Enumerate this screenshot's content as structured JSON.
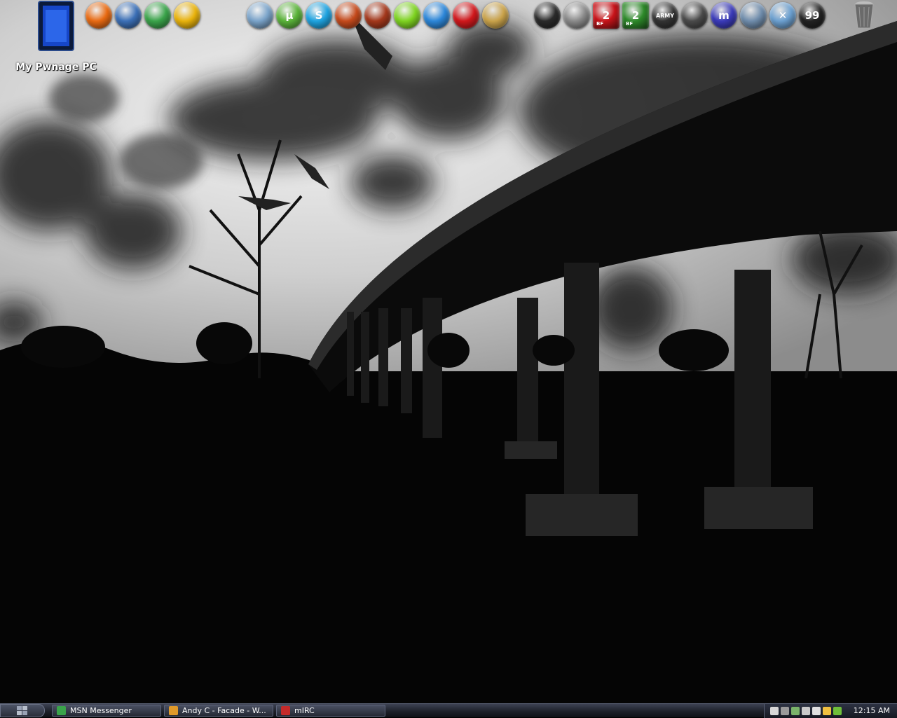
{
  "desktop": {
    "my_computer_label": "My Pwnage PC"
  },
  "dock_left": [
    {
      "name": "firefox-icon",
      "color": "#e86a12"
    },
    {
      "name": "thunderbird-icon",
      "color": "#3b6fb6"
    },
    {
      "name": "msn-icon",
      "color": "#3aa34a"
    },
    {
      "name": "aim-icon",
      "color": "#e8b20c"
    }
  ],
  "dock_center": [
    {
      "name": "feather-icon",
      "color": "#7aa3c9"
    },
    {
      "name": "utorrent-icon",
      "color": "#5bb33a",
      "glyph": "µ"
    },
    {
      "name": "skype-icon",
      "color": "#1fa3e0",
      "glyph": "S"
    },
    {
      "name": "fire-icon",
      "color": "#c44a1c"
    },
    {
      "name": "comet-icon",
      "color": "#a3381c"
    },
    {
      "name": "limewire-icon",
      "color": "#7ed321"
    },
    {
      "name": "bird-icon",
      "color": "#2c86d8"
    },
    {
      "name": "stop-icon",
      "color": "#d0181c"
    },
    {
      "name": "cpu-icon",
      "color": "#c9a24a"
    }
  ],
  "dock_right": [
    {
      "name": "steam-icon",
      "color": "#2a2a2a"
    },
    {
      "name": "counter-strike-icon",
      "color": "#8a8a8a"
    },
    {
      "name": "bf2-red-icon",
      "color": "#c8141a",
      "glyph": "2",
      "sub": "BF"
    },
    {
      "name": "bf2-green-icon",
      "color": "#2e8a2a",
      "glyph": "2",
      "sub": "BF"
    },
    {
      "name": "americas-army-icon",
      "color": "#333333",
      "glyph": "ARMY"
    },
    {
      "name": "halo-icon",
      "color": "#4a4a4a"
    },
    {
      "name": "mirc-icon",
      "color": "#3a3ab8",
      "glyph": "m"
    },
    {
      "name": "speaker-icon",
      "color": "#6f8cab"
    },
    {
      "name": "x-icon",
      "color": "#6b9fcf",
      "glyph": "✕"
    },
    {
      "name": "monitor-icon",
      "color": "#222222",
      "glyph": "99"
    }
  ],
  "recycle_bin": {
    "name": "recycle-bin-icon"
  },
  "taskbar": {
    "buttons": [
      {
        "label": "MSN Messenger",
        "icon_color": "#3aa34a"
      },
      {
        "label": "Andy C - Facade - W...",
        "icon_color": "#e09a2a"
      },
      {
        "label": "mIRC",
        "icon_color": "#c42a2a"
      }
    ],
    "clock": "12:15 AM",
    "tray_colors": [
      "#d7d7d7",
      "#9a9a9a",
      "#7ab36a",
      "#c9c9c9",
      "#e0e0e0",
      "#f0c040",
      "#6fbf3a"
    ]
  }
}
